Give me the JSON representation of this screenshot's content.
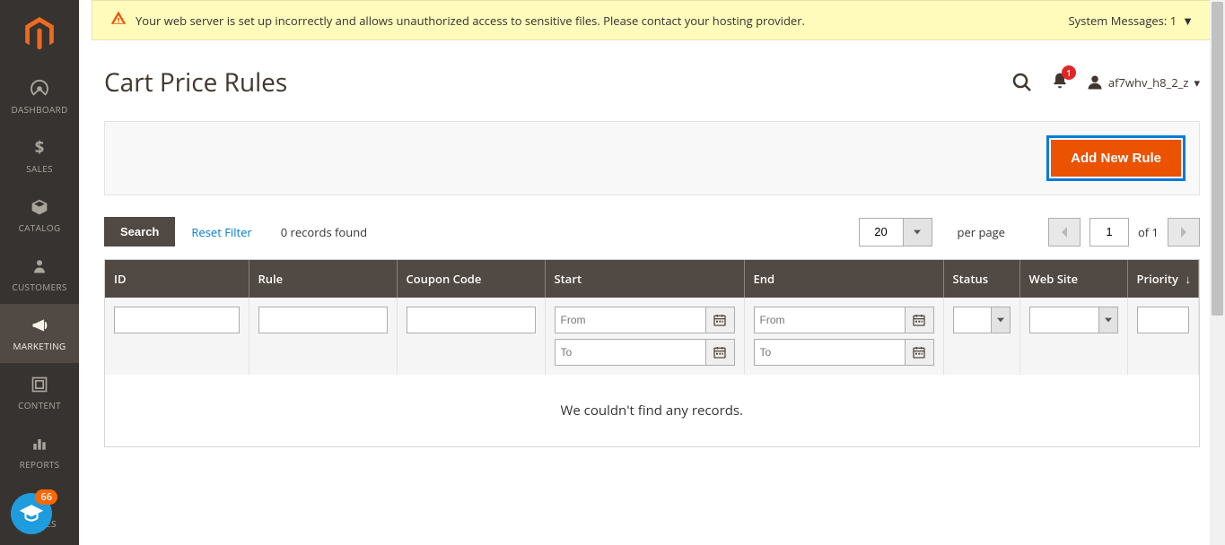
{
  "sidebar": {
    "items": [
      {
        "label": "DASHBOARD",
        "icon": "dashboard"
      },
      {
        "label": "SALES",
        "icon": "dollar"
      },
      {
        "label": "CATALOG",
        "icon": "box"
      },
      {
        "label": "CUSTOMERS",
        "icon": "person"
      },
      {
        "label": "MARKETING",
        "icon": "megaphone",
        "active": true
      },
      {
        "label": "CONTENT",
        "icon": "blocks"
      },
      {
        "label": "REPORTS",
        "icon": "bars"
      },
      {
        "label": "STORES",
        "icon": "storefront"
      }
    ]
  },
  "system_message": {
    "text": "Your web server is set up incorrectly and allows unauthorized access to sensitive files. Please contact your hosting provider.",
    "label": "System Messages:",
    "count": "1"
  },
  "page_title": "Cart Price Rules",
  "header": {
    "notification_count": "1",
    "username": "af7whv_h8_2_z"
  },
  "primary_action": "Add New Rule",
  "toolbar": {
    "search_label": "Search",
    "reset_label": "Reset Filter",
    "records_found": "0 records found",
    "per_page_value": "20",
    "per_page_label": "per page",
    "page_current": "1",
    "page_of": "of 1"
  },
  "grid": {
    "columns": [
      "ID",
      "Rule",
      "Coupon Code",
      "Start",
      "End",
      "Status",
      "Web Site",
      "Priority"
    ],
    "date_placeholders": {
      "from": "From",
      "to": "To"
    },
    "empty_message": "We couldn't find any records."
  },
  "help_badge": "66"
}
